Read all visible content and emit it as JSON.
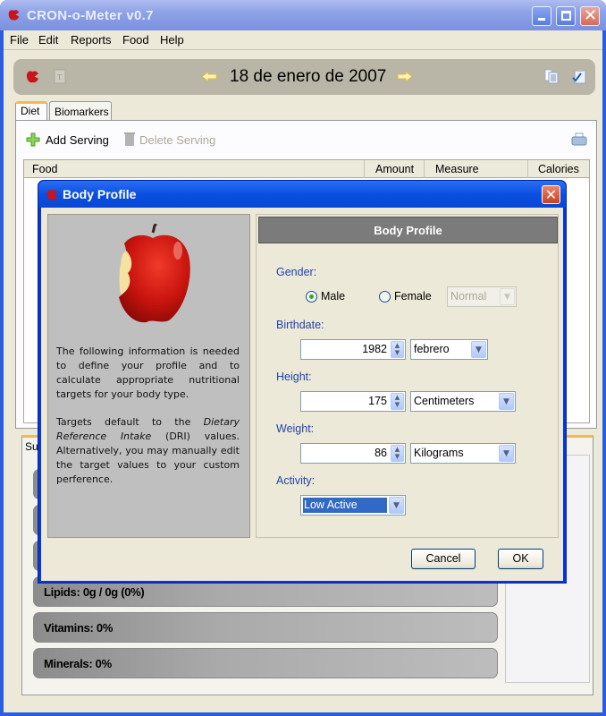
{
  "window": {
    "title": "CRON-o-Meter v0.7",
    "controls": [
      "minimize",
      "maximize",
      "close"
    ]
  },
  "menu": [
    "File",
    "Edit",
    "Reports",
    "Food",
    "Help"
  ],
  "datebar": {
    "date": "18 de enero de 2007",
    "icons": [
      "apple-logo-icon",
      "text-note-icon",
      "prev-day-arrow-icon",
      "next-day-arrow-icon",
      "copy-list-icon",
      "checklist-icon"
    ]
  },
  "tabs": [
    {
      "label": "Diet",
      "active": true
    },
    {
      "label": "Biomarkers",
      "active": false
    }
  ],
  "toolbar": {
    "add_serving": "Add Serving",
    "delete_serving": "Delete Serving"
  },
  "food_table": {
    "columns": [
      "Food",
      "Amount",
      "Measure",
      "Calories"
    ],
    "rows": []
  },
  "summary": {
    "tab_label_visible": "Su",
    "bars": [
      {
        "label": "Lipids: 0g / 0g (0%)"
      },
      {
        "label": "Vitamins: 0%"
      },
      {
        "label": "Minerals: 0%"
      }
    ]
  },
  "dialog": {
    "title": "Body Profile",
    "header": "Body Profile",
    "info_p1": "The following information is needed to define your profile and to calculate appropriate nutritional targets for your body type.",
    "info_p2_pre": "Targets default to the ",
    "info_p2_italic": "Dietary Reference Intake",
    "info_p2_post": " (DRI) values. Alternatively, you may manually edit the target values to your custom perference.",
    "gender_label": "Gender:",
    "gender_options": [
      {
        "label": "Male",
        "selected": true
      },
      {
        "label": "Female",
        "selected": false
      }
    ],
    "pregnancy_status": "Normal",
    "birthdate_label": "Birthdate:",
    "birth_year": "1982",
    "birth_month": "febrero",
    "height_label": "Height:",
    "height_value": "175",
    "height_unit": "Centimeters",
    "weight_label": "Weight:",
    "weight_value": "86",
    "weight_unit": "Kilograms",
    "activity_label": "Activity:",
    "activity_value": "Low Active",
    "cancel_label": "Cancel",
    "ok_label": "OK"
  },
  "colors": {
    "title_bar": "#8ea2e6",
    "dialog_title": "#0a4fe0",
    "field_label": "#1f46a8",
    "selection": "#316ac5",
    "tab_highlight": "#f6b84e"
  }
}
